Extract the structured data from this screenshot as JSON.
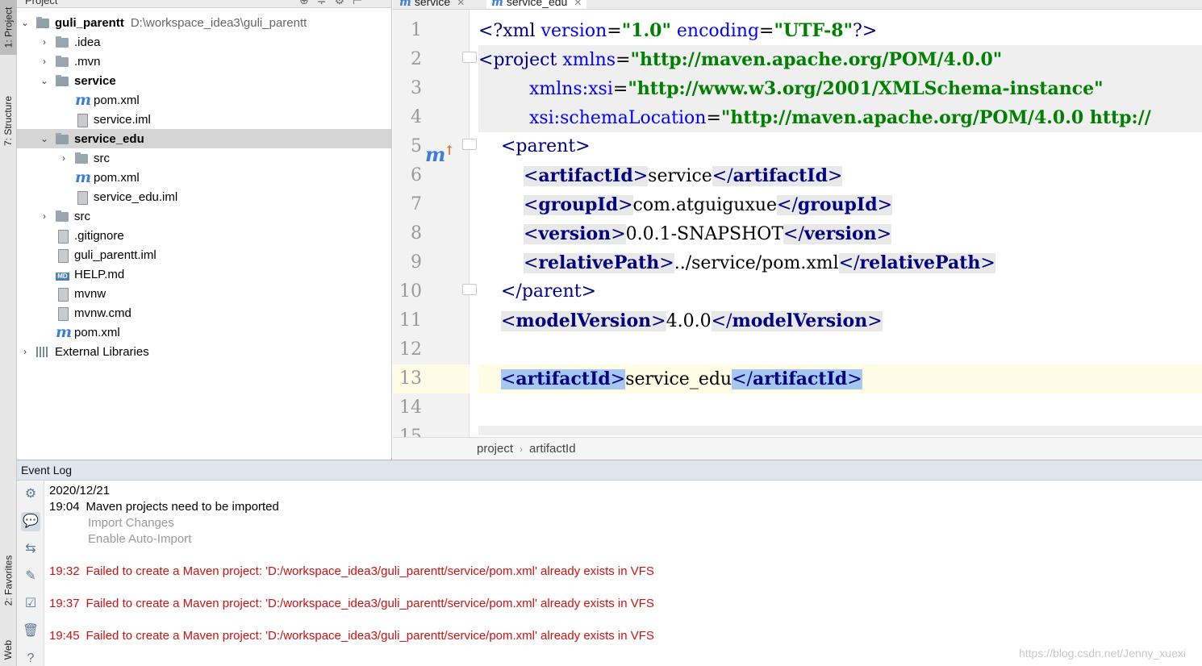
{
  "left_strip": {
    "project_tab": "1: Project",
    "structure_tab": "7: Structure",
    "favorites_tab": "2: Favorites",
    "web_tab": "Web"
  },
  "project_panel": {
    "title": "Project",
    "tree": [
      {
        "label": "guli_parentt",
        "path": "D:\\workspace_idea3\\guli_parentt",
        "bold": true
      },
      {
        "label": ".idea"
      },
      {
        "label": ".mvn"
      },
      {
        "label": "service",
        "bold": true
      },
      {
        "label": "pom.xml"
      },
      {
        "label": "service.iml"
      },
      {
        "label": "service_edu",
        "bold": true
      },
      {
        "label": "src"
      },
      {
        "label": "pom.xml"
      },
      {
        "label": "service_edu.iml"
      },
      {
        "label": "src"
      },
      {
        "label": ".gitignore"
      },
      {
        "label": "guli_parentt.iml"
      },
      {
        "label": "HELP.md"
      },
      {
        "label": "mvnw"
      },
      {
        "label": "mvnw.cmd"
      },
      {
        "label": "pom.xml"
      },
      {
        "label": "External Libraries"
      }
    ]
  },
  "editor": {
    "tabs": [
      {
        "label": "service"
      },
      {
        "label": "service_edu"
      }
    ],
    "line_numbers": [
      "1",
      "2",
      "3",
      "4",
      "5",
      "6",
      "7",
      "8",
      "9",
      "10",
      "11",
      "12",
      "13",
      "14",
      "15"
    ],
    "code": {
      "l1_decl": "<?xml",
      "l1_a1": "version",
      "l1_v1": "\"1.0\"",
      "l1_a2": "encoding",
      "l1_v2": "\"UTF-8\"",
      "l1_end": "?>",
      "l2_tag": "project",
      "l2_attr": "xmlns",
      "l2_val": "\"http://maven.apache.org/POM/4.0.0\"",
      "l3_attr": "xmlns:xsi",
      "l3_val": "\"http://www.w3.org/2001/XMLSchema-instance\"",
      "l4_attr": "xsi:schemaLocation",
      "l4_val": "\"http://maven.apache.org/POM/4.0.0 http://",
      "parent": "parent",
      "artifactId": "artifactId",
      "groupId": "groupId",
      "version": "version",
      "relativePath": "relativePath",
      "modelVersion": "modelVersion",
      "v_service": "service",
      "v_group": "com.atguiguxue",
      "v_version": "0.0.1-SNAPSHOT",
      "v_relpath": "../service/pom.xml",
      "v_model": "4.0.0",
      "v_artifact": "service_edu"
    },
    "breadcrumb": [
      "project",
      "artifactId"
    ]
  },
  "event_log": {
    "title": "Event Log",
    "date": "2020/12/21",
    "entries": [
      {
        "time": "19:04",
        "message": "Maven projects need to be imported"
      },
      {
        "time": "19:32",
        "message": "Failed to create a Maven project: 'D:/workspace_idea3/guli_parentt/service/pom.xml' already exists in VFS"
      },
      {
        "time": "19:37",
        "message": "Failed to create a Maven project: 'D:/workspace_idea3/guli_parentt/service/pom.xml' already exists in VFS"
      },
      {
        "time": "19:45",
        "message": "Failed to create a Maven project: 'D:/workspace_idea3/guli_parentt/service/pom.xml' already exists in VFS"
      }
    ],
    "links": {
      "import_changes": "Import Changes",
      "enable_auto_import": "Enable Auto-Import"
    }
  },
  "watermark": "https://blog.csdn.net/Jenny_xuexi",
  "icons": {
    "maven_file": "m",
    "chevron_right": "›",
    "chevron_down": "⌄"
  },
  "colors": {
    "xml_tag": "#000080",
    "xml_attr": "#0000ff",
    "xml_value": "#008000",
    "error_text": "#cc1010",
    "match_highlight": "#a6c8f0",
    "current_line": "#fefce4"
  }
}
